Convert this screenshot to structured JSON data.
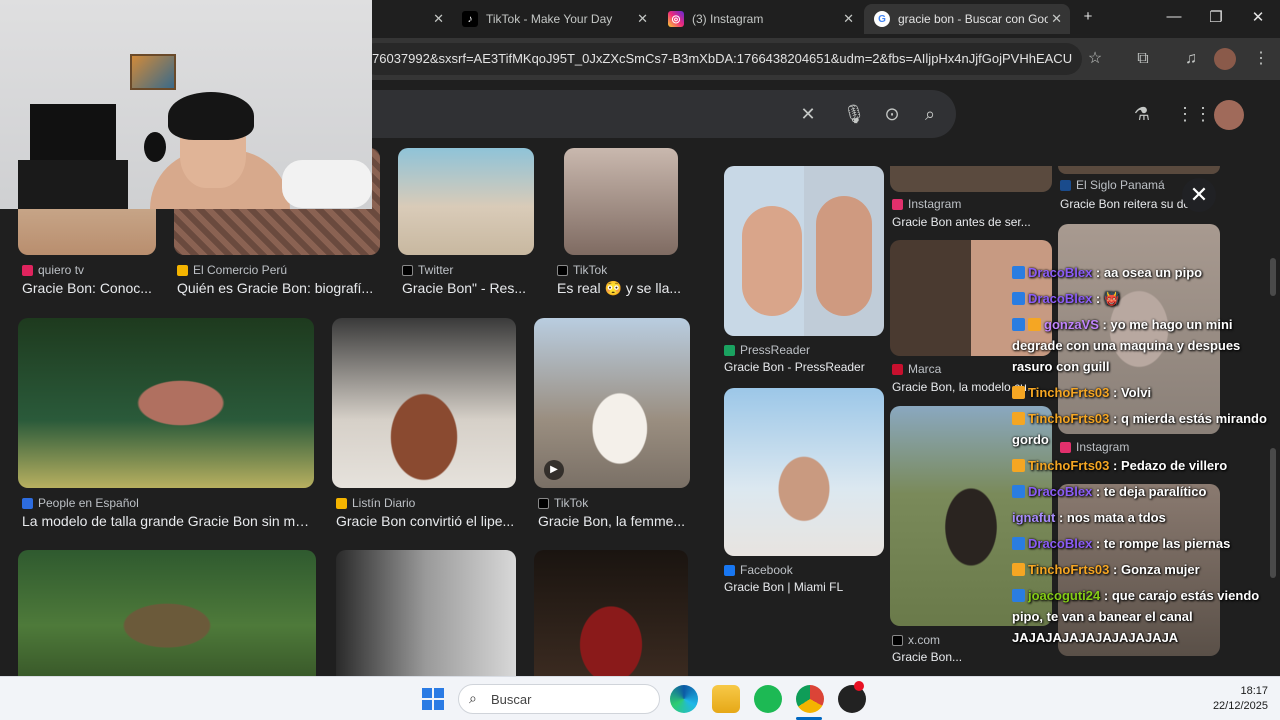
{
  "browser": {
    "tabs": [
      {
        "label": "",
        "active": false
      },
      {
        "label": "TikTok - Make Your Day",
        "active": false
      },
      {
        "label": "(3) Instagram",
        "active": false
      },
      {
        "label": "gracie bon - Buscar con Goo",
        "active": true
      }
    ],
    "url": "76037992&sxsrf=AE3TifMKqoJ95T_0JxZXcSmCs7-B3mXbDA:1766438204651&udm=2&fbs=AIljpHx4nJjfGojPVHhEACUH..."
  },
  "results": [
    {
      "source": "quiero tv",
      "title": "Gracie Bon: Conoc..."
    },
    {
      "source": "El Comercio Perú",
      "title": "Quién es Gracie Bon: biografí..."
    },
    {
      "source": "Twitter",
      "title": "Gracie Bon\" - Res..."
    },
    {
      "source": "TikTok",
      "title": "Es real 😳 y se lla..."
    },
    {
      "source": "People en Español",
      "title": "La modelo de talla grande Gracie Bon sin ma..."
    },
    {
      "source": "Listín Diario",
      "title": "Gracie Bon convirtió el lipe..."
    },
    {
      "source": "TikTok",
      "title": "Gracie Bon, la femme..."
    }
  ],
  "panel": {
    "items": [
      {
        "source": "PressReader",
        "title": "Gracie Bon - PressReader"
      },
      {
        "source": "Instagram",
        "title": "Gracie Bon antes de ser..."
      },
      {
        "source": "Marca",
        "title": "Gracie Bon, la modelo curv..."
      },
      {
        "source": "El Siglo Panamá",
        "title": "Gracie Bon reitera su dese..."
      },
      {
        "source": "Facebook",
        "title": "Gracie Bon | Miami FL"
      },
      {
        "source": "x.com",
        "title": "Gracie Bon..."
      },
      {
        "source": "Instagram",
        "title": ""
      }
    ]
  },
  "chat": [
    {
      "user": "DracoBlex",
      "color": "#8b5cf6",
      "text": "aa osea un pipo"
    },
    {
      "user": "DracoBlex",
      "color": "#8b5cf6",
      "text": "👹"
    },
    {
      "user": "gonzaVS",
      "color": "#c084fc",
      "text": "yo me hago un mini degrade con una maquina y despues rasuro con guill"
    },
    {
      "user": "TinchoFrts03",
      "color": "#f5a623",
      "text": "Volvi"
    },
    {
      "user": "TinchoFrts03",
      "color": "#f5a623",
      "text": "q mierda estás mirando gordo"
    },
    {
      "user": "TinchoFrts03",
      "color": "#f5a623",
      "text": "Pedazo de villero"
    },
    {
      "user": "DracoBlex",
      "color": "#8b5cf6",
      "text": "te deja paralítico"
    },
    {
      "user": "ignafut",
      "color": "#a78bfa",
      "text": "nos mata a tdos"
    },
    {
      "user": "DracoBlex",
      "color": "#8b5cf6",
      "text": "te rompe las piernas"
    },
    {
      "user": "TinchoFrts03",
      "color": "#f5a623",
      "text": "Gonza mujer"
    },
    {
      "user": "joacoguti24",
      "color": "#84cc16",
      "text": "que carajo estás viendo pipo, te van a banear el canal JAJAJAJAJAJAJAJAJAJA"
    }
  ],
  "taskbar": {
    "search_placeholder": "Buscar",
    "time": "18:17",
    "date": "22/12/2025"
  },
  "colors": {
    "accent": "#8ab4f8",
    "tiktok": "#000000",
    "instagram": "#e1306c"
  }
}
